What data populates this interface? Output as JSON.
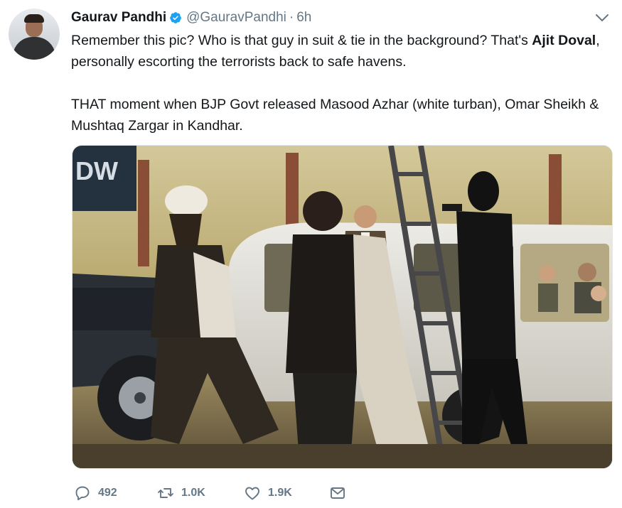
{
  "author": {
    "name": "Gaurav Pandhi",
    "handle": "@GauravPandhi",
    "separator": "·",
    "time": "6h"
  },
  "tweet": {
    "line1_prefix": "Remember this pic? Who is that guy in suit & tie in the background? That's ",
    "line1_bold": "Ajit Doval",
    "line1_suffix": ", personally escorting the terrorists back to safe havens.",
    "paragraph2": "THAT moment when BJP Govt released Masood Azhar (white turban), Omar Sheikh & Mushtaq Zargar in Kandhar."
  },
  "media": {
    "sign_text": "DW"
  },
  "actions": {
    "replies": "492",
    "retweets": "1.0K",
    "likes": "1.9K"
  },
  "icons": {
    "verified": "verified-badge-icon",
    "chevron": "chevron-down-icon",
    "reply": "reply-icon",
    "retweet": "retweet-icon",
    "like": "heart-icon",
    "dm": "envelope-icon"
  },
  "colors": {
    "verified": "#1da1f2",
    "secondary_text": "#657786",
    "primary_text": "#14171a"
  }
}
